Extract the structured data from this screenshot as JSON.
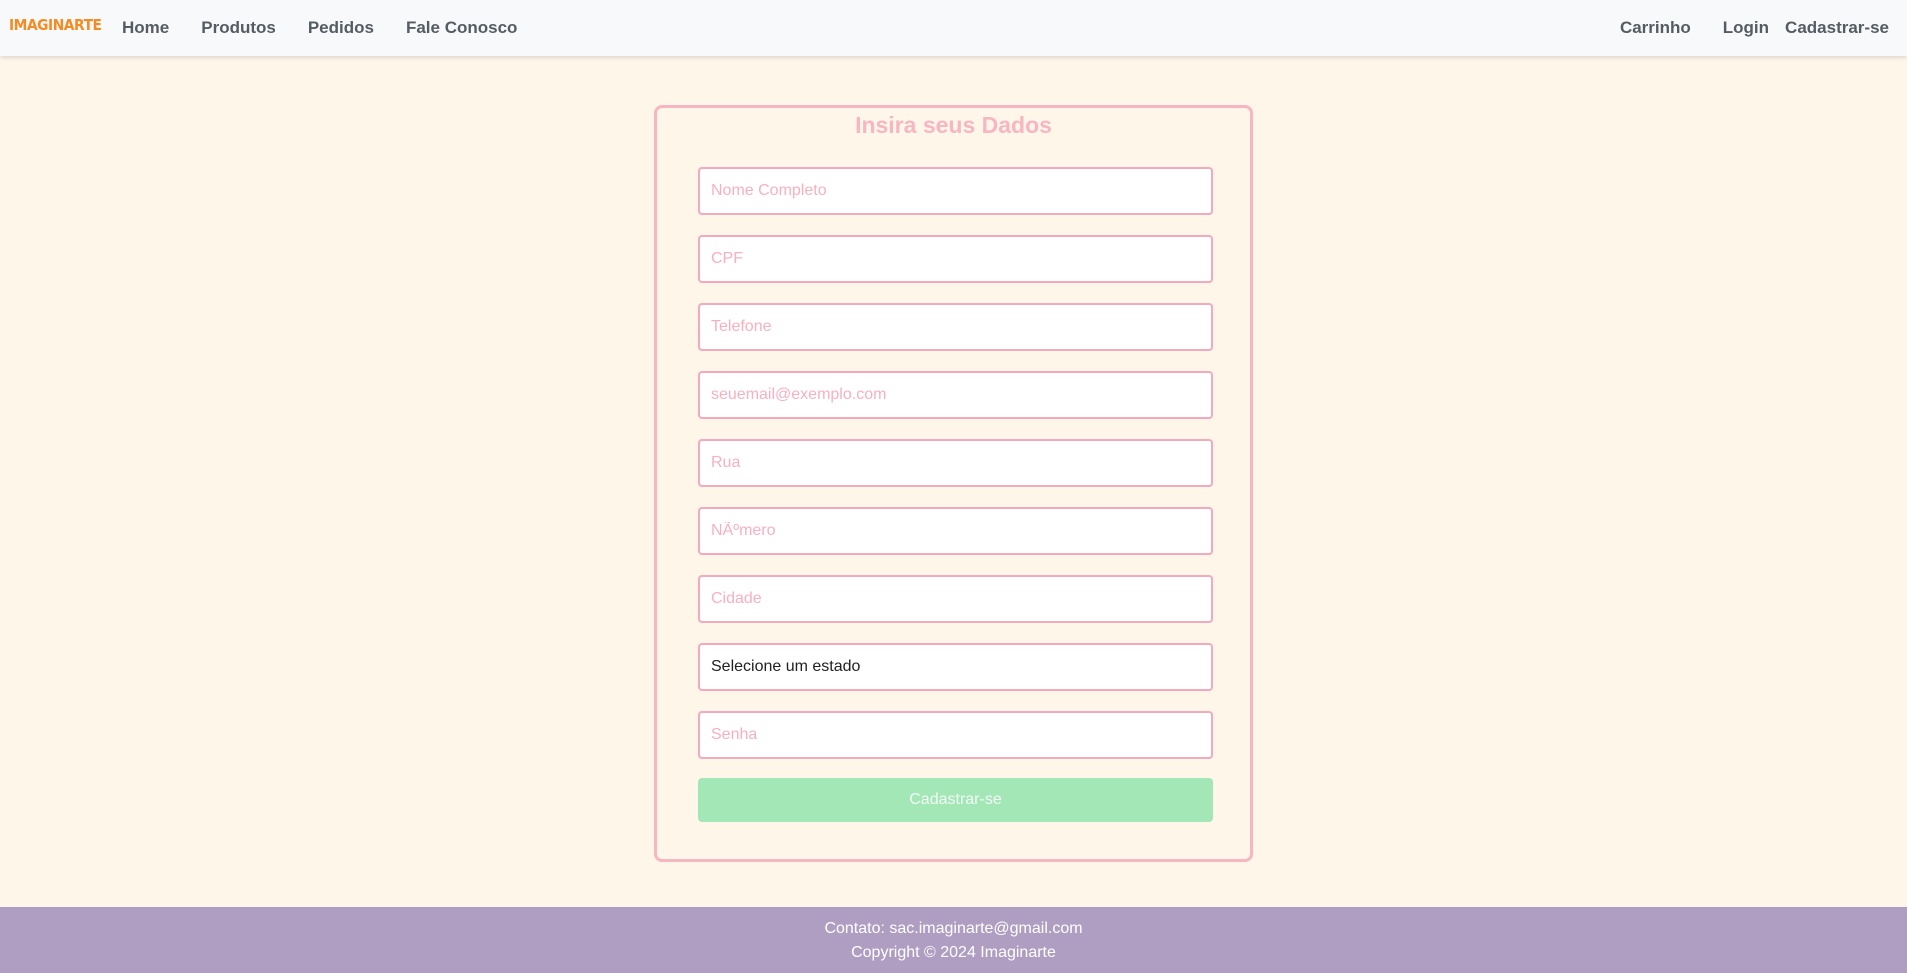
{
  "navbar": {
    "brand": "IMAGINARTE",
    "left_links": [
      "Home",
      "Produtos",
      "Pedidos",
      "Fale Conosco"
    ],
    "right_links": [
      "Carrinho",
      "Login",
      "Cadastrar-se"
    ]
  },
  "form": {
    "title": "Insira seus Dados",
    "fields": {
      "nome": {
        "placeholder": "Nome Completo",
        "value": ""
      },
      "cpf": {
        "placeholder": "CPF",
        "value": ""
      },
      "telefone": {
        "placeholder": "Telefone",
        "value": ""
      },
      "email": {
        "placeholder": "seuemail@exemplo.com",
        "value": ""
      },
      "rua": {
        "placeholder": "Rua",
        "value": ""
      },
      "numero": {
        "placeholder": "NÃºmero",
        "value": ""
      },
      "cidade": {
        "placeholder": "Cidade",
        "value": ""
      },
      "estado": {
        "selected": "Selecione um estado"
      },
      "senha": {
        "placeholder": "Senha",
        "value": ""
      }
    },
    "submit_label": "Cadastrar-se"
  },
  "footer": {
    "contact": "Contato: sac.imaginarte@gmail.com",
    "copyright": "Copyright © 2024 Imaginarte"
  },
  "colors": {
    "background": "#fff6ea",
    "brand": "#f58b22",
    "field_border": "#f5a9bc",
    "submit": "#a3e7b7",
    "footer": "#af9dc2"
  }
}
